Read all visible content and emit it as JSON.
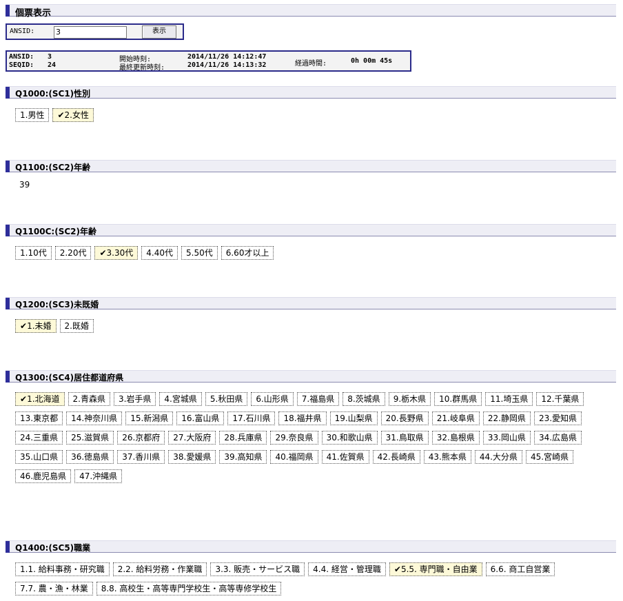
{
  "page_title": "個票表示",
  "search": {
    "label": "ANSID:",
    "value": "3",
    "button": "表示"
  },
  "info": {
    "ansid_label": "ANSID:",
    "ansid": "3",
    "seqid_label": "SEQID:",
    "seqid": "24",
    "start_label": "開始時刻:",
    "start": "2014/11/26  14:12:47",
    "update_label": "最終更新時刻:",
    "update": "2014/11/26  14:13:32",
    "elapsed_label": "経過時間:",
    "elapsed": "0h 00m 45s"
  },
  "check_mark": "✔",
  "sections": [
    {
      "title": "Q1000:(SC1)性別",
      "options": [
        {
          "label": "1.男性",
          "selected": false
        },
        {
          "label": "2.女性",
          "selected": true
        }
      ]
    },
    {
      "title": "Q1100:(SC2)年齢",
      "answer": "39"
    },
    {
      "title": "Q1100C:(SC2)年齢",
      "options": [
        {
          "label": "1.10代",
          "selected": false
        },
        {
          "label": "2.20代",
          "selected": false
        },
        {
          "label": "3.30代",
          "selected": true
        },
        {
          "label": "4.40代",
          "selected": false
        },
        {
          "label": "5.50代",
          "selected": false
        },
        {
          "label": "6.60才以上",
          "selected": false
        }
      ]
    },
    {
      "title": "Q1200:(SC3)未既婚",
      "options": [
        {
          "label": "1.未婚",
          "selected": true
        },
        {
          "label": "2.既婚",
          "selected": false
        }
      ]
    },
    {
      "title": "Q1300:(SC4)居住都道府県",
      "options": [
        {
          "label": "1.北海道",
          "selected": true
        },
        {
          "label": "2.青森県",
          "selected": false
        },
        {
          "label": "3.岩手県",
          "selected": false
        },
        {
          "label": "4.宮城県",
          "selected": false
        },
        {
          "label": "5.秋田県",
          "selected": false
        },
        {
          "label": "6.山形県",
          "selected": false
        },
        {
          "label": "7.福島県",
          "selected": false
        },
        {
          "label": "8.茨城県",
          "selected": false
        },
        {
          "label": "9.栃木県",
          "selected": false
        },
        {
          "label": "10.群馬県",
          "selected": false
        },
        {
          "label": "11.埼玉県",
          "selected": false
        },
        {
          "label": "12.千葉県",
          "selected": false
        },
        {
          "label": "13.東京都",
          "selected": false
        },
        {
          "label": "14.神奈川県",
          "selected": false
        },
        {
          "label": "15.新潟県",
          "selected": false
        },
        {
          "label": "16.富山県",
          "selected": false
        },
        {
          "label": "17.石川県",
          "selected": false
        },
        {
          "label": "18.福井県",
          "selected": false
        },
        {
          "label": "19.山梨県",
          "selected": false
        },
        {
          "label": "20.長野県",
          "selected": false
        },
        {
          "label": "21.岐阜県",
          "selected": false
        },
        {
          "label": "22.静岡県",
          "selected": false
        },
        {
          "label": "23.愛知県",
          "selected": false
        },
        {
          "label": "24.三重県",
          "selected": false
        },
        {
          "label": "25.滋賀県",
          "selected": false
        },
        {
          "label": "26.京都府",
          "selected": false
        },
        {
          "label": "27.大阪府",
          "selected": false
        },
        {
          "label": "28.兵庫県",
          "selected": false
        },
        {
          "label": "29.奈良県",
          "selected": false
        },
        {
          "label": "30.和歌山県",
          "selected": false
        },
        {
          "label": "31.鳥取県",
          "selected": false
        },
        {
          "label": "32.島根県",
          "selected": false
        },
        {
          "label": "33.岡山県",
          "selected": false
        },
        {
          "label": "34.広島県",
          "selected": false
        },
        {
          "label": "35.山口県",
          "selected": false
        },
        {
          "label": "36.徳島県",
          "selected": false
        },
        {
          "label": "37.香川県",
          "selected": false
        },
        {
          "label": "38.愛媛県",
          "selected": false
        },
        {
          "label": "39.高知県",
          "selected": false
        },
        {
          "label": "40.福岡県",
          "selected": false
        },
        {
          "label": "41.佐賀県",
          "selected": false
        },
        {
          "label": "42.長崎県",
          "selected": false
        },
        {
          "label": "43.熊本県",
          "selected": false
        },
        {
          "label": "44.大分県",
          "selected": false
        },
        {
          "label": "45.宮崎県",
          "selected": false
        },
        {
          "label": "46.鹿児島県",
          "selected": false
        },
        {
          "label": "47.沖縄県",
          "selected": false
        }
      ]
    },
    {
      "title": "Q1400:(SC5)職業",
      "options": [
        {
          "label": "1.1. 給料事務・研究職",
          "selected": false
        },
        {
          "label": "2.2. 給料労務・作業職",
          "selected": false
        },
        {
          "label": "3.3. 販売・サービス職",
          "selected": false
        },
        {
          "label": "4.4. 経営・管理職",
          "selected": false
        },
        {
          "label": "5.5. 専門職・自由業",
          "selected": true
        },
        {
          "label": "6.6. 商工自営業",
          "selected": false
        },
        {
          "label": "7.7. 農・漁・林業",
          "selected": false
        },
        {
          "label": "8.8. 高校生・高等専門学校生・高等専修学校生",
          "selected": false
        }
      ]
    }
  ]
}
